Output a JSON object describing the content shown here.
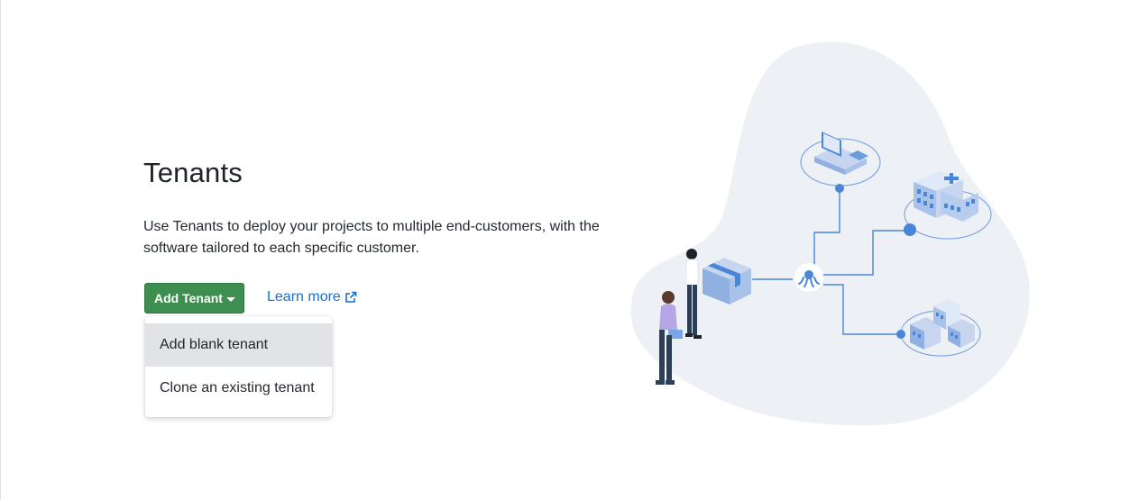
{
  "header": {
    "title": "Tenants",
    "description": "Use Tenants to deploy your projects to multiple end-customers, with the software tailored to each specific customer."
  },
  "actions": {
    "add_tenant_label": "Add Tenant",
    "learn_more_label": "Learn more"
  },
  "dropdown": {
    "items": [
      {
        "label": "Add blank tenant",
        "highlighted": true
      },
      {
        "label": "Clone an existing tenant",
        "highlighted": false
      }
    ]
  },
  "colors": {
    "primary_button": "#3e8e4f",
    "link": "#1a6fd0",
    "illustration_accent": "#4a86d8",
    "blob": "#edf0f5"
  },
  "icons": {
    "caret": "chevron-down-icon",
    "external": "external-link-icon"
  }
}
